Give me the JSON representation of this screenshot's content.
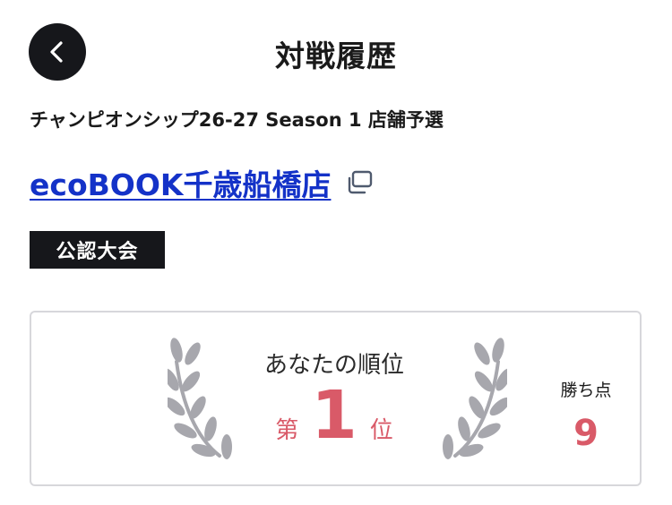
{
  "header": {
    "title": "対戦履歴",
    "back_icon": "chevron-left-icon"
  },
  "event": {
    "name": "チャンピオンシップ26-27 Season 1 店舗予選",
    "store": "ecoBOOK千歳船橋店",
    "copy_icon": "copy-icon",
    "badge": "公認大会"
  },
  "result": {
    "rank_label": "あなたの順位",
    "rank_prefix": "第",
    "rank_value": "1",
    "rank_suffix": "位",
    "points_label": "勝ち点",
    "points_value": "9",
    "laurel_icon": "laurel-wreath-icon"
  },
  "colors": {
    "accent": "#d95a68",
    "link": "#1432c8",
    "dark": "#16171b",
    "laurel": "#a7a7ad",
    "card_border": "#d7d7db"
  }
}
